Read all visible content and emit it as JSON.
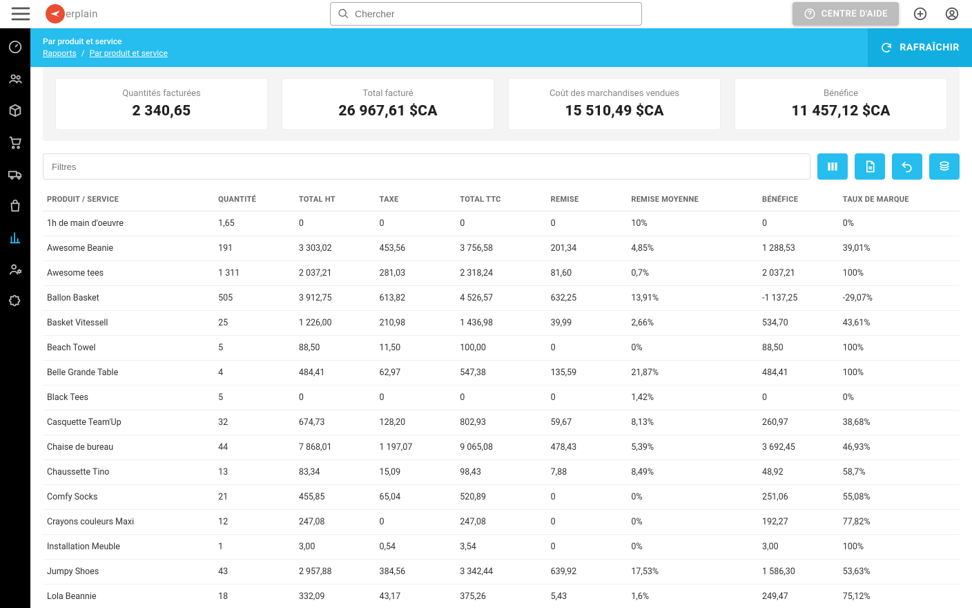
{
  "top": {
    "search_placeholder": "Chercher",
    "help_label": "CENTRE D'AIDE",
    "logo_text": "erplain"
  },
  "header": {
    "title": "Par produit et service",
    "crumb1": "Rapports",
    "crumb2": "Par produit et service",
    "refresh": "RAFRAÎCHIR"
  },
  "stats": [
    {
      "label": "Quantités facturées",
      "value": "2 340,65"
    },
    {
      "label": "Total facturé",
      "value": "26 967,61 $CA"
    },
    {
      "label": "Coût des marchandises vendues",
      "value": "15 510,49 $CA"
    },
    {
      "label": "Bénéfice",
      "value": "11 457,12 $CA"
    }
  ],
  "filters_placeholder": "Filtres",
  "columns": [
    "PRODUIT / SERVICE",
    "QUANTITÉ",
    "TOTAL HT",
    "TAXE",
    "TOTAL TTC",
    "REMISE",
    "REMISE MOYENNE",
    "BÉNÉFICE",
    "TAUX DE MARQUE"
  ],
  "rows": [
    [
      "1h de main d'oeuvre",
      "1,65",
      "0",
      "0",
      "0",
      "0",
      "10%",
      "0",
      "0%"
    ],
    [
      "Awesome Beanie",
      "191",
      "3 303,02",
      "453,56",
      "3 756,58",
      "201,34",
      "4,85%",
      "1 288,53",
      "39,01%"
    ],
    [
      "Awesome tees",
      "1 311",
      "2 037,21",
      "281,03",
      "2 318,24",
      "81,60",
      "0,7%",
      "2 037,21",
      "100%"
    ],
    [
      "Ballon Basket",
      "505",
      "3 912,75",
      "613,82",
      "4 526,57",
      "632,25",
      "13,91%",
      "-1 137,25",
      "-29,07%"
    ],
    [
      "Basket Vitessell",
      "25",
      "1 226,00",
      "210,98",
      "1 436,98",
      "39,99",
      "2,66%",
      "534,70",
      "43,61%"
    ],
    [
      "Beach Towel",
      "5",
      "88,50",
      "11,50",
      "100,00",
      "0",
      "0%",
      "88,50",
      "100%"
    ],
    [
      "Belle Grande Table",
      "4",
      "484,41",
      "62,97",
      "547,38",
      "135,59",
      "21,87%",
      "484,41",
      "100%"
    ],
    [
      "Black Tees",
      "5",
      "0",
      "0",
      "0",
      "0",
      "1,42%",
      "0",
      "0%"
    ],
    [
      "Casquette Team'Up",
      "32",
      "674,73",
      "128,20",
      "802,93",
      "59,67",
      "8,13%",
      "260,97",
      "38,68%"
    ],
    [
      "Chaise de bureau",
      "44",
      "7 868,01",
      "1 197,07",
      "9 065,08",
      "478,43",
      "5,39%",
      "3 692,45",
      "46,93%"
    ],
    [
      "Chaussette Tino",
      "13",
      "83,34",
      "15,09",
      "98,43",
      "7,88",
      "8,49%",
      "48,92",
      "58,7%"
    ],
    [
      "Comfy Socks",
      "21",
      "455,85",
      "65,04",
      "520,89",
      "0",
      "0%",
      "251,06",
      "55,08%"
    ],
    [
      "Crayons couleurs Maxi",
      "12",
      "247,08",
      "0",
      "247,08",
      "0",
      "0%",
      "192,27",
      "77,82%"
    ],
    [
      "Installation Meuble",
      "1",
      "3,00",
      "0,54",
      "3,54",
      "0",
      "0%",
      "3,00",
      "100%"
    ],
    [
      "Jumpy Shoes",
      "43",
      "2 957,88",
      "384,56",
      "3 342,44",
      "639,92",
      "17,53%",
      "1 586,30",
      "53,63%"
    ],
    [
      "Lola Beannie",
      "18",
      "332,09",
      "43,17",
      "375,26",
      "5,43",
      "1,6%",
      "249,47",
      "75,12%"
    ]
  ]
}
